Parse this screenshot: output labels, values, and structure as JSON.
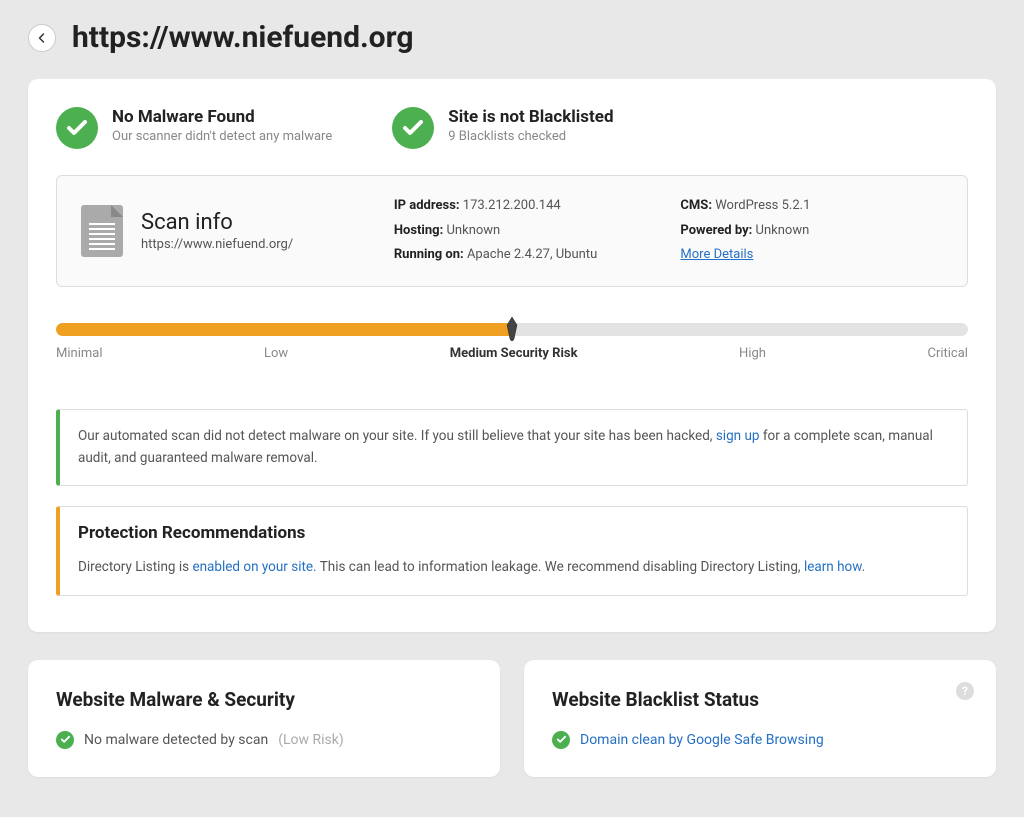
{
  "header": {
    "url": "https://www.niefuend.org"
  },
  "status": {
    "malware": {
      "title": "No Malware Found",
      "subtitle": "Our scanner didn't detect any malware"
    },
    "blacklist": {
      "title": "Site is not Blacklisted",
      "subtitle": "9 Blacklists checked"
    }
  },
  "scan_info": {
    "title": "Scan info",
    "url": "https://www.niefuend.org/",
    "ip_label": "IP address:",
    "ip_value": "173.212.200.144",
    "hosting_label": "Hosting:",
    "hosting_value": "Unknown",
    "running_label": "Running on:",
    "running_value": "Apache 2.4.27, Ubuntu",
    "cms_label": "CMS:",
    "cms_value": "WordPress 5.2.1",
    "powered_label": "Powered by:",
    "powered_value": "Unknown",
    "more_details": "More Details"
  },
  "risk": {
    "percent": 50,
    "labels": [
      "Minimal",
      "Low",
      "Medium Security Risk",
      "High",
      "Critical"
    ],
    "active_index": 2
  },
  "alert": {
    "text_before": "Our automated scan did not detect malware on your site. If you still believe that your site has been hacked, ",
    "link": "sign up",
    "text_after": " for a complete scan, manual audit, and guaranteed malware removal."
  },
  "recommendations": {
    "heading": "Protection Recommendations",
    "text_before": "Directory Listing is ",
    "link1": "enabled on your site.",
    "text_mid": " This can lead to information leakage. We recommend disabling Directory Listing, ",
    "link2": "learn how",
    "text_after": "."
  },
  "malware_card": {
    "heading": "Website Malware & Security",
    "item_text": "No malware detected by scan",
    "item_muted": "(Low Risk)"
  },
  "blacklist_card": {
    "heading": "Website Blacklist Status",
    "item_link": "Domain clean by Google Safe Browsing"
  }
}
